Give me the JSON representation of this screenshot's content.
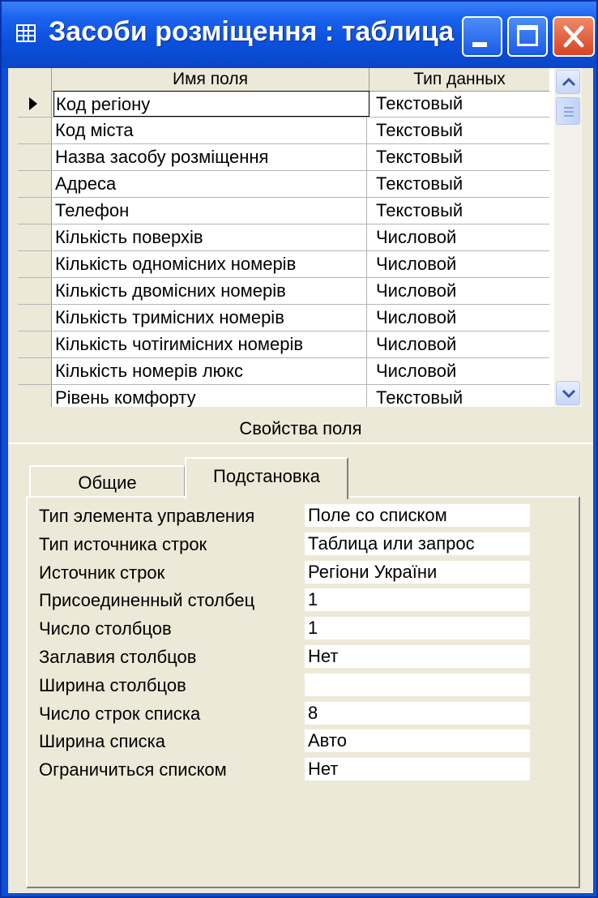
{
  "window": {
    "title": "Засоби розміщення : таблица"
  },
  "grid": {
    "columns": [
      "Имя поля",
      "Тип данных"
    ],
    "rows": [
      {
        "name": "Код регіону",
        "type": "Текстовый"
      },
      {
        "name": "Код міста",
        "type": "Текстовый"
      },
      {
        "name": "Назва засобу розміщення",
        "type": "Текстовый"
      },
      {
        "name": "Адреса",
        "type": "Текстовый"
      },
      {
        "name": "Телефон",
        "type": "Текстовый"
      },
      {
        "name": "Кількість поверхів",
        "type": "Числовой"
      },
      {
        "name": "Кількість одномісних номерів",
        "type": "Числовой"
      },
      {
        "name": "Кількість двомісних номерів",
        "type": "Числовой"
      },
      {
        "name": "Кількість тримісних номерів",
        "type": "Числовой"
      },
      {
        "name": "Кількість чотirимісних номерів",
        "type": "Числовой"
      },
      {
        "name": "Кількість номерів люкс",
        "type": "Числовой"
      },
      {
        "name": "Рівень комфорту",
        "type": "Текстовый"
      }
    ]
  },
  "properties": {
    "title": "Свойства поля",
    "tabs": [
      "Общие",
      "Подстановка"
    ],
    "active_tab": "Подстановка",
    "items": [
      {
        "label": "Тип элемента управления",
        "value": "Поле со списком"
      },
      {
        "label": "Тип источника строк",
        "value": "Таблица или запрос"
      },
      {
        "label": "Источник строк",
        "value": "Регіони України"
      },
      {
        "label": "Присоединенный столбец",
        "value": "1"
      },
      {
        "label": "Число столбцов",
        "value": "1"
      },
      {
        "label": "Заглавия столбцов",
        "value": "Нет"
      },
      {
        "label": "Ширина столбцов",
        "value": ""
      },
      {
        "label": "Число строк списка",
        "value": "8"
      },
      {
        "label": "Ширина списка",
        "value": "Авто"
      },
      {
        "label": "Ограничиться списком",
        "value": "Нет"
      }
    ]
  },
  "icons": {
    "app": "table-icon",
    "minimize": "minimize-icon",
    "maximize": "maximize-icon",
    "close": "close-icon",
    "scroll_up": "chevron-up-icon",
    "scroll_down": "chevron-down-icon",
    "current_row": "row-pointer-icon"
  },
  "colors": {
    "titlebar": "#0b50dc",
    "close_button": "#d64422",
    "client": "#ece9d8"
  }
}
